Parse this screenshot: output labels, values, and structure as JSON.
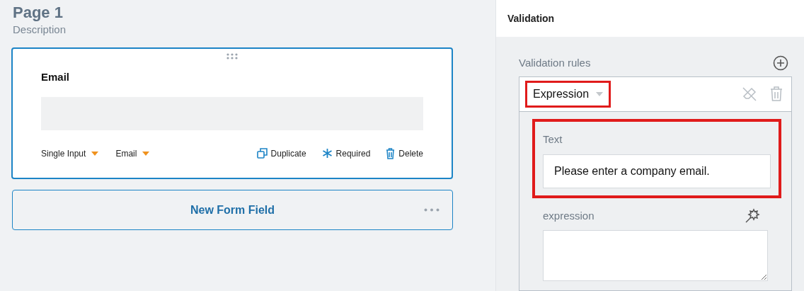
{
  "page": {
    "title": "Page 1",
    "description": "Description"
  },
  "field_card": {
    "label": "Email",
    "selected": true,
    "type_dropdown": "Single Input",
    "format_dropdown": "Email",
    "actions": [
      {
        "kind": "duplicate",
        "label": "Duplicate"
      },
      {
        "kind": "required",
        "label": "Required"
      },
      {
        "kind": "delete",
        "label": "Delete"
      }
    ]
  },
  "new_field_button": "New Form Field",
  "panel": {
    "title": "Validation",
    "section_label": "Validation rules",
    "rule": {
      "type": "Expression",
      "text_label": "Text",
      "text_value": "Please enter a company email.",
      "expression_label": "expression"
    }
  }
}
